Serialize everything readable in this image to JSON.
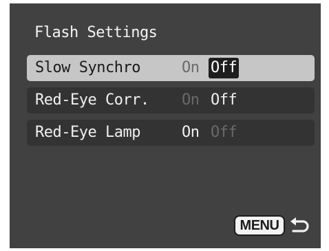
{
  "screen": {
    "title": "Flash Settings"
  },
  "settings": [
    {
      "label": "Slow Synchro",
      "on_label": "On",
      "off_label": "Off",
      "value": "Off",
      "selected": true
    },
    {
      "label": "Red-Eye Corr.",
      "on_label": "On",
      "off_label": "Off",
      "value": "Off",
      "selected": false
    },
    {
      "label": "Red-Eye Lamp",
      "on_label": "On",
      "off_label": "Off",
      "value": "On",
      "selected": false
    }
  ],
  "footer": {
    "menu_label": "MENU",
    "return_icon": "return-arrow-icon"
  },
  "colors": {
    "background": "#414141",
    "row": "#333333",
    "row_selected": "#c6c6c6",
    "text": "#f0f0f0",
    "text_inactive": "#6a6a6a"
  }
}
